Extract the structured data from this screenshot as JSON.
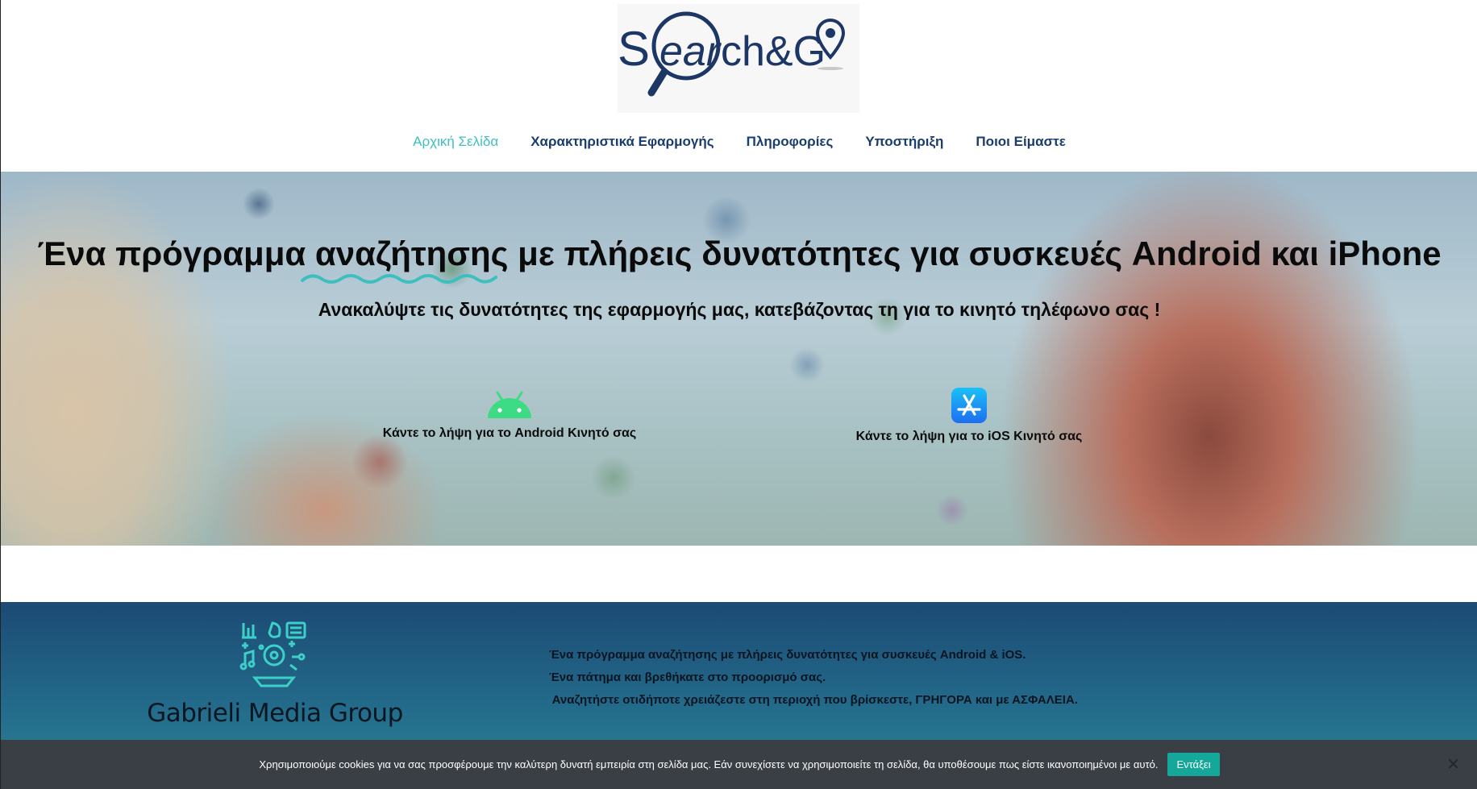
{
  "logo": {
    "text": "Search&GO"
  },
  "nav": {
    "items": [
      {
        "label": "Αρχική Σελίδα",
        "active": true
      },
      {
        "label": "Χαρακτηριστικά Εφαρμογής",
        "active": false
      },
      {
        "label": "Πληροφορίες",
        "active": false
      },
      {
        "label": "Υποστήριξη",
        "active": false
      },
      {
        "label": "Ποιοι Είμαστε",
        "active": false
      }
    ]
  },
  "hero": {
    "title": "Ένα πρόγραμμα αναζήτησης με πλήρεις δυνατότητες για συσκευές Android και iPhone",
    "subtitle": "Ανακαλύψτε τις δυνατότητες της εφαρμογής μας, κατεβάζοντας τη για το κινητό τηλέφωνο σας !",
    "android_label": "Κάντε το λήψη για το Android Κινητό σας",
    "ios_label": "Κάντε το λήψη για το iOS Κινητό σας",
    "android_icon": "android-icon",
    "ios_icon": "app-store-icon"
  },
  "footer": {
    "brand": "Gabrieli Media Group",
    "lines": [
      "Ένα πρόγραμμα αναζήτησης με πλήρεις δυνατότητες για συσκευές Android & iOS.",
      "Ένα πάτημα και βρεθήκατε στο προορισμό σας.",
      " Αναζητήστε οτιδήποτε χρειάζεστε στη περιοχή που βρίσκεστε, ΓΡΗΓΟΡΑ και με ΑΣΦΑΛΕΙΑ."
    ]
  },
  "cookie": {
    "text": "Χρησιμοποιούμε cookies για να σας προσφέρουμε την καλύτερη δυνατή εμπειρία στη σελίδα μας. Εάν συνεχίσετε να χρησιμοποιείτε τη σελίδα, θα υποθέσουμε πως είστε ικανοποιημένοι με αυτό.",
    "accept": "Εντάξει",
    "close": "✕"
  },
  "colors": {
    "nav_active": "#3dbfc0",
    "nav": "#1a3c6e",
    "teal_accent": "#3dbfc0",
    "android_green": "#3ddc84",
    "ios_blue": "#1e90f0",
    "cookie_bg": "#3a3f46",
    "cookie_button": "#15a89a"
  }
}
